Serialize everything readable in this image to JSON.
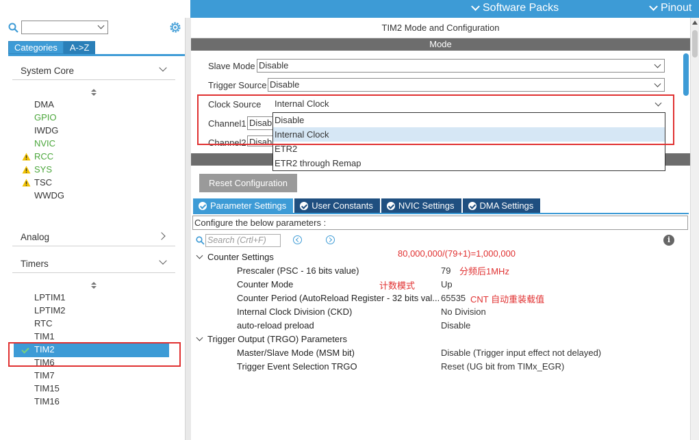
{
  "topbar": {
    "software_packs": "Software Packs",
    "pinout": "Pinout",
    "bg_color": "#3d9bd6"
  },
  "left": {
    "search_value": "",
    "tabs": [
      {
        "label": "Categories",
        "active": true
      },
      {
        "label": "A->Z",
        "active": false
      }
    ],
    "groups": {
      "system_core": "System Core",
      "analog": "Analog",
      "timers": "Timers"
    },
    "system_core_items": [
      {
        "label": "DMA",
        "status": "normal"
      },
      {
        "label": "GPIO",
        "status": "green"
      },
      {
        "label": "IWDG",
        "status": "normal"
      },
      {
        "label": "NVIC",
        "status": "green"
      },
      {
        "label": "RCC",
        "status": "warning"
      },
      {
        "label": "SYS",
        "status": "warning"
      },
      {
        "label": "TSC",
        "status": "warning"
      },
      {
        "label": "WWDG",
        "status": "normal"
      }
    ],
    "timer_items": [
      {
        "label": "LPTIM1",
        "status": "normal"
      },
      {
        "label": "LPTIM2",
        "status": "normal"
      },
      {
        "label": "RTC",
        "status": "normal"
      },
      {
        "label": "TIM1",
        "status": "normal"
      },
      {
        "label": "TIM2",
        "status": "selected"
      },
      {
        "label": "TIM6",
        "status": "normal"
      },
      {
        "label": "TIM7",
        "status": "normal"
      },
      {
        "label": "TIM15",
        "status": "normal"
      },
      {
        "label": "TIM16",
        "status": "normal"
      }
    ]
  },
  "config": {
    "title": "TIM2 Mode and Configuration",
    "mode_header": "Mode",
    "fields": {
      "slave_mode_label": "Slave Mode",
      "slave_mode_value": "Disable",
      "trigger_source_label": "Trigger Source",
      "trigger_source_value": "Disable",
      "clock_source_label": "Clock Source",
      "clock_source_value": "Internal Clock",
      "channel1_label": "Channel1",
      "channel1_value": "Disab",
      "channel2_label": "Channel2",
      "channel2_value": "Disab"
    },
    "clock_source_options": [
      "Disable",
      "Internal Clock",
      "ETR2",
      "ETR2 through Remap"
    ],
    "clock_source_selected_index": 1,
    "reset_button": "Reset Configuration",
    "param_tabs": [
      {
        "label": "Parameter Settings",
        "active": true
      },
      {
        "label": "User Constants",
        "active": false
      },
      {
        "label": "NVIC Settings",
        "active": false
      },
      {
        "label": "DMA Settings",
        "active": false
      }
    ],
    "configure_text": "Configure the below parameters :",
    "search_placeholder": "Search (Crtl+F)",
    "counter_settings": {
      "title": "Counter Settings",
      "params": [
        {
          "name": "Prescaler (PSC - 16 bits value)",
          "value": "79"
        },
        {
          "name": "Counter Mode",
          "value": "Up"
        },
        {
          "name": "Counter Period (AutoReload Register - 32 bits val...",
          "value": "65535"
        },
        {
          "name": "Internal Clock Division (CKD)",
          "value": "No Division"
        },
        {
          "name": "auto-reload preload",
          "value": "Disable"
        }
      ]
    },
    "trigger_output": {
      "title": "Trigger Output (TRGO) Parameters",
      "params": [
        {
          "name": "Master/Slave Mode (MSM bit)",
          "value": "Disable (Trigger input effect not delayed)"
        },
        {
          "name": "Trigger Event Selection TRGO",
          "value": "Reset (UG bit from TIMx_EGR)"
        }
      ]
    }
  },
  "annotations": {
    "formula": "80,000,000/(79+1)=1,000,000",
    "prescaler_note": "分频后1MHz",
    "counter_mode_note": "计数模式",
    "period_note": "CNT 自动重装载值",
    "color": "#e03030"
  }
}
